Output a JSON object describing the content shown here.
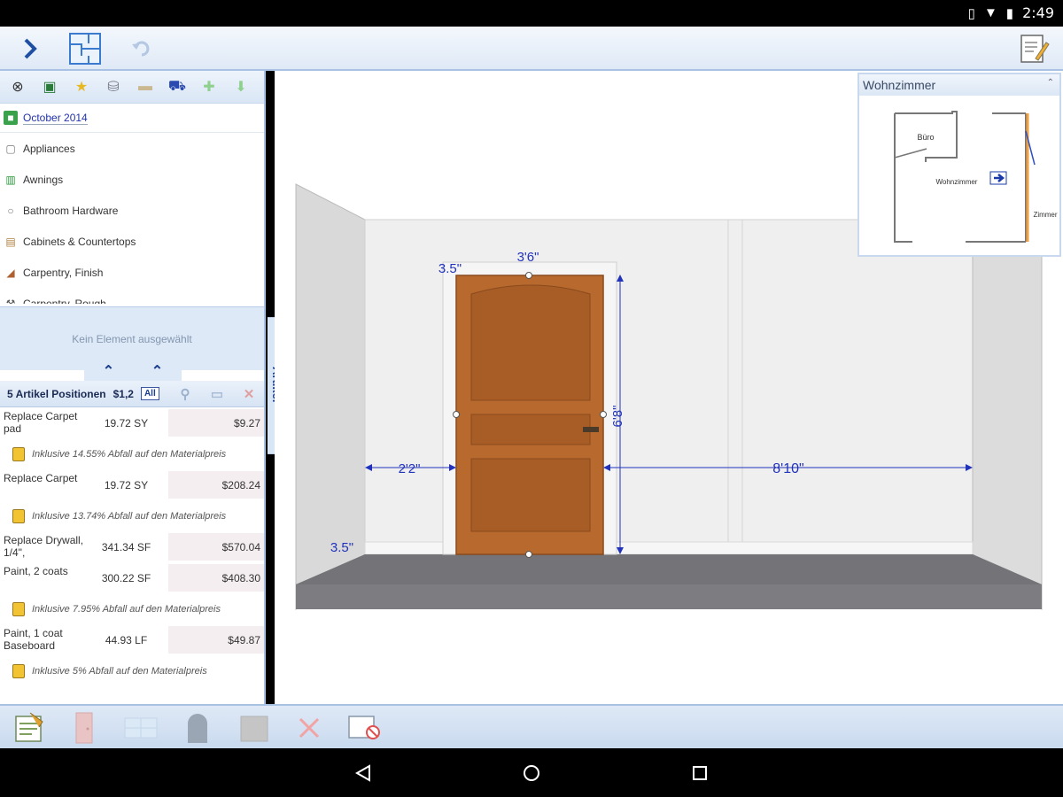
{
  "status_bar": {
    "time": "2:49",
    "icons": [
      "vibrate-icon",
      "wifi-icon",
      "battery-icon"
    ]
  },
  "toolbar": {
    "buttons": [
      "chevron-right-icon",
      "floorplan-icon",
      "undo-icon",
      "notes-icon"
    ]
  },
  "left_panel": {
    "icon_row": [
      "binoculars-icon",
      "photo-icon",
      "star-icon",
      "cylinder-icon",
      "tag-icon",
      "cart-icon",
      "add-icon",
      "download-icon"
    ],
    "period": "October 2014",
    "categories": [
      {
        "label": "Appliances",
        "icon": "box-icon"
      },
      {
        "label": "Awnings",
        "icon": "awning-icon"
      },
      {
        "label": "Bathroom Hardware",
        "icon": "ring-icon"
      },
      {
        "label": "Cabinets & Countertops",
        "icon": "cabinet-icon"
      },
      {
        "label": "Carpentry, Finish",
        "icon": "saw-icon"
      },
      {
        "label": "Carpentry, Rough",
        "icon": "hammer-icon"
      }
    ],
    "no_selection": "Kein Element ausgewählt",
    "positions_header": "5 Artikel Positionen",
    "positions_total": "$1,2",
    "all_label": "All",
    "items": [
      {
        "type": "row",
        "desc": "Replace Carpet pad",
        "qty": "19.72 SY",
        "price": "$9.27"
      },
      {
        "type": "note",
        "text": "Inklusive 14.55% Abfall auf den Materialpreis"
      },
      {
        "type": "row",
        "desc": "Replace Carpet",
        "qty": "19.72 SY",
        "price": "$208.24"
      },
      {
        "type": "note",
        "text": "Inklusive 13.74% Abfall auf den Materialpreis"
      },
      {
        "type": "row",
        "desc": "Replace Drywall, 1/4\",",
        "qty": "341.34 SF",
        "price": "$570.04"
      },
      {
        "type": "row",
        "desc": "Paint, 2 coats",
        "qty": "300.22 SF",
        "price": "$408.30"
      },
      {
        "type": "note",
        "text": "Inklusive 7.95% Abfall auf den Materialpreis"
      },
      {
        "type": "row",
        "desc": "Paint, 1 coat Baseboard",
        "qty": "44.93 LF",
        "price": "$49.87"
      },
      {
        "type": "note",
        "text": "Inklusive 5% Abfall auf den Materialpreis"
      }
    ]
  },
  "side_tab": {
    "label": "Artikel"
  },
  "elevation": {
    "dim_top": "3'6\"",
    "dim_left_top": "3.5\"",
    "dim_height": "6'8\"",
    "dim_left": "2'2\"",
    "dim_right": "8'10\"",
    "dim_bottom_left": "3.5\""
  },
  "minimap": {
    "title": "Wohnzimmer",
    "rooms": [
      "Büro",
      "Wohnzimmer",
      "Zimmer"
    ]
  },
  "bottom_toolbar": [
    "estimate-icon",
    "door-icon",
    "window-icon",
    "arch-icon",
    "box-icon",
    "delete-icon",
    "cancel-icon"
  ],
  "navbar": [
    "back-icon",
    "home-icon",
    "recents-icon"
  ]
}
